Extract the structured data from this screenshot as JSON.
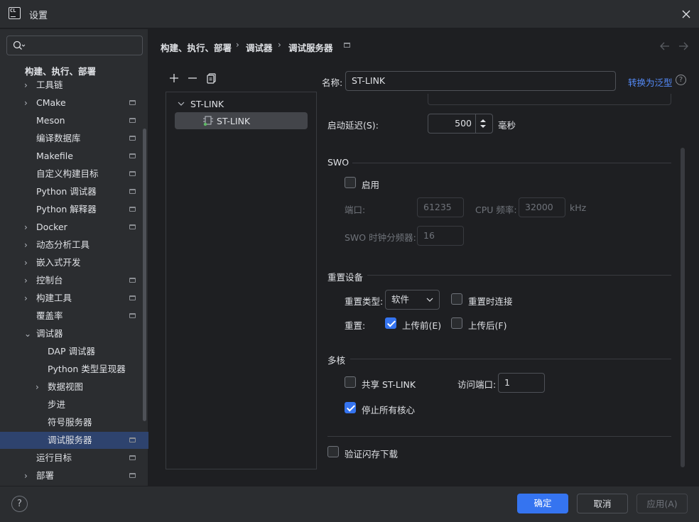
{
  "window": {
    "title": "设置",
    "logo_text": "CL"
  },
  "search": {
    "placeholder": ""
  },
  "sidebar": {
    "section_title": "构建、执行、部署",
    "items": [
      {
        "label": "工具链",
        "expandable": true,
        "pinned": false
      },
      {
        "label": "CMake",
        "expandable": true,
        "pinned": true
      },
      {
        "label": "Meson",
        "expandable": false,
        "pinned": true
      },
      {
        "label": "编译数据库",
        "expandable": false,
        "pinned": true
      },
      {
        "label": "Makefile",
        "expandable": false,
        "pinned": true
      },
      {
        "label": "自定义构建目标",
        "expandable": false,
        "pinned": true
      },
      {
        "label": "Python 调试器",
        "expandable": false,
        "pinned": true
      },
      {
        "label": "Python 解释器",
        "expandable": false,
        "pinned": true
      },
      {
        "label": "Docker",
        "expandable": true,
        "pinned": true
      },
      {
        "label": "动态分析工具",
        "expandable": true,
        "pinned": false
      },
      {
        "label": "嵌入式开发",
        "expandable": true,
        "pinned": false
      },
      {
        "label": "控制台",
        "expandable": true,
        "pinned": true
      },
      {
        "label": "构建工具",
        "expandable": true,
        "pinned": true
      },
      {
        "label": "覆盖率",
        "expandable": false,
        "pinned": true
      },
      {
        "label": "调试器",
        "expandable": true,
        "expanded": true,
        "pinned": false
      },
      {
        "label": "DAP 调试器",
        "expandable": false,
        "pinned": false,
        "child": true
      },
      {
        "label": "Python 类型呈现器",
        "expandable": false,
        "pinned": false,
        "child": true
      },
      {
        "label": "数据视图",
        "expandable": true,
        "pinned": false,
        "child": true
      },
      {
        "label": "步进",
        "expandable": false,
        "pinned": false,
        "child": true
      },
      {
        "label": "符号服务器",
        "expandable": false,
        "pinned": false,
        "child": true
      },
      {
        "label": "调试服务器",
        "expandable": false,
        "pinned": true,
        "child": true,
        "selected": true
      },
      {
        "label": "运行目标",
        "expandable": false,
        "pinned": true
      },
      {
        "label": "部署",
        "expandable": true,
        "pinned": true
      }
    ]
  },
  "breadcrumb": [
    "构建、执行、部署",
    "调试器",
    "调试服务器"
  ],
  "tree": {
    "group_label": "ST-LINK",
    "child_label": "ST-LINK"
  },
  "form": {
    "name_label": "名称:",
    "name_value": "ST-LINK",
    "convert_link": "转换为泛型",
    "startup_delay_label": "启动延迟(S):",
    "startup_delay_value": "500",
    "startup_delay_unit": "毫秒",
    "swo": {
      "title": "SWO",
      "enable_label": "启用",
      "enable_checked": false,
      "port_label": "端口:",
      "port_value": "61235",
      "cpu_freq_label": "CPU 频率:",
      "cpu_freq_value": "32000",
      "cpu_freq_unit": "kHz",
      "divider_label": "SWO 时钟分频器:",
      "divider_value": "16"
    },
    "reset": {
      "title": "重置设备",
      "type_label": "重置类型:",
      "type_value": "软件",
      "connect_under_reset_label": "重置时连接",
      "connect_under_reset_checked": false,
      "reset_label": "重置:",
      "before_upload_label": "上传前(E)",
      "before_upload_checked": true,
      "after_upload_label": "上传后(F)",
      "after_upload_checked": false
    },
    "multicore": {
      "title": "多核",
      "share_label": "共享 ST-LINK",
      "share_checked": false,
      "access_port_label": "访问端口:",
      "access_port_value": "1",
      "halt_all_label": "停止所有核心",
      "halt_all_checked": true
    },
    "verify_flash_label": "验证闪存下载",
    "verify_flash_checked": false
  },
  "buttons": {
    "ok": "确定",
    "cancel": "取消",
    "apply": "应用(A)",
    "help": "?"
  },
  "colors": {
    "accent": "#3574f0",
    "selection": "#2e436e",
    "link": "#548af7"
  }
}
